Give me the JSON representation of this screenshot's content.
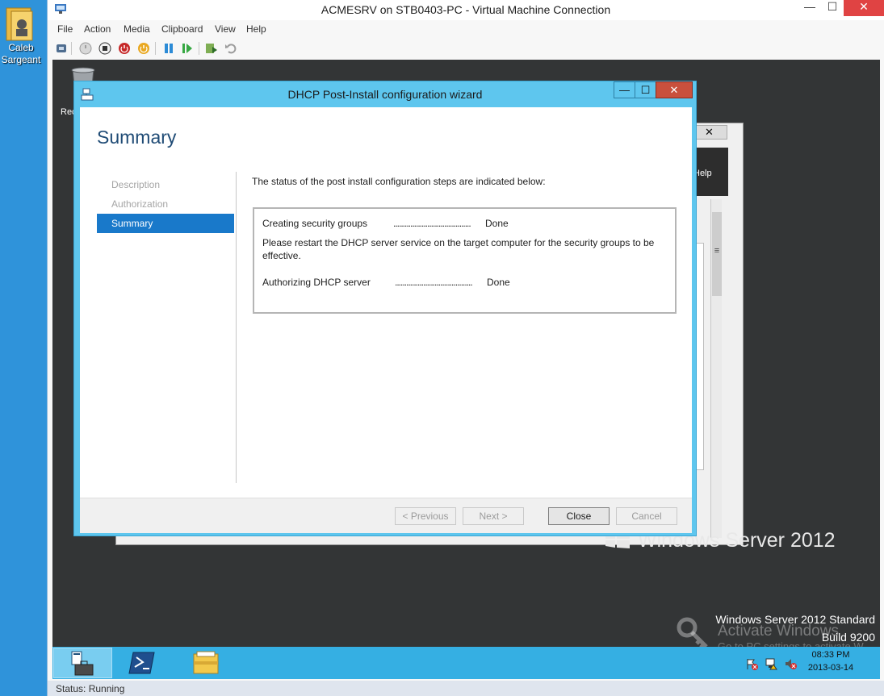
{
  "host": {
    "user_label": "Caleb Sargeant"
  },
  "vmc": {
    "title": "ACMESRV on STB0403-PC - Virtual Machine Connection",
    "menu": [
      "File",
      "Action",
      "Media",
      "Clipboard",
      "View",
      "Help"
    ],
    "toolbar_icons": [
      "ctrl-alt-del-icon",
      "start-icon",
      "turn-off-icon",
      "shutdown-icon",
      "save-icon",
      "pause-icon",
      "resume-icon",
      "checkpoint-icon",
      "revert-icon"
    ],
    "status": "Status: Running",
    "controls": {
      "minimize": "—",
      "maximize": "☐",
      "close": "✕"
    }
  },
  "guest": {
    "recycle_label": "Rec",
    "server_manager": {
      "help": "Help",
      "close": "✕",
      "scroll_grip": "≡"
    },
    "branding": {
      "product": "Windows Server 2012",
      "edition": "Windows Server 2012 Standard",
      "build": "Build 9200",
      "activate": "Activate Windows",
      "activate_sub": "Go to PC settings to activate W"
    },
    "taskbar": {
      "items": [
        "server-manager-icon",
        "powershell-icon",
        "file-explorer-icon"
      ],
      "time": "08:33 PM",
      "date": "2013-03-14"
    }
  },
  "dialog": {
    "title": "DHCP Post-Install configuration wizard",
    "controls": {
      "minimize": "—",
      "maximize": "☐",
      "close": "✕"
    },
    "heading": "Summary",
    "nav": [
      {
        "label": "Description",
        "active": false
      },
      {
        "label": "Authorization",
        "active": false
      },
      {
        "label": "Summary",
        "active": true
      }
    ],
    "intro": "The status of the post install configuration steps are indicated below:",
    "steps": [
      {
        "name": "Creating security groups",
        "dots": ".........................................",
        "status": "Done"
      },
      {
        "name": "Authorizing DHCP server",
        "dots": ".........................................",
        "status": "Done"
      }
    ],
    "note": "Please restart the DHCP server service on the target computer for the security groups to be effective.",
    "buttons": {
      "previous": "< Previous",
      "next": "Next >",
      "close": "Close",
      "cancel": "Cancel"
    }
  }
}
